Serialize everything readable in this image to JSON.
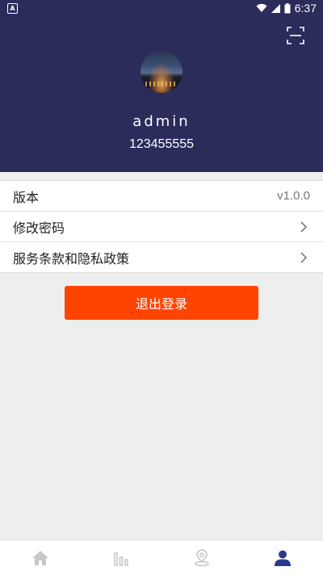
{
  "status_bar": {
    "time": "6:37",
    "app_icon_letter": "A",
    "icons": [
      "wifi-icon",
      "cell-signal-icon",
      "battery-icon"
    ]
  },
  "header": {
    "scan_icon": "scan-icon",
    "username": "admin",
    "user_id": "123455555"
  },
  "menu": {
    "items": [
      {
        "label": "版本",
        "value": "v1.0.0"
      },
      {
        "label": "修改密码",
        "icon": "chevron-right-icon"
      },
      {
        "label": "服务条款和隐私政策",
        "icon": "chevron-right-icon"
      }
    ]
  },
  "logout_label": "退出登录",
  "tab_bar": {
    "tabs": [
      {
        "icon": "home-icon",
        "active": false
      },
      {
        "icon": "chart-icon",
        "active": false
      },
      {
        "icon": "location-icon",
        "active": false
      },
      {
        "icon": "user-icon",
        "active": true
      }
    ],
    "active_color": "#2b3a8c",
    "inactive_color": "#c8c8c8"
  },
  "colors": {
    "header_bg": "#2b2c5a",
    "accent_button": "#ff4400",
    "page_bg": "#eeeeee"
  }
}
